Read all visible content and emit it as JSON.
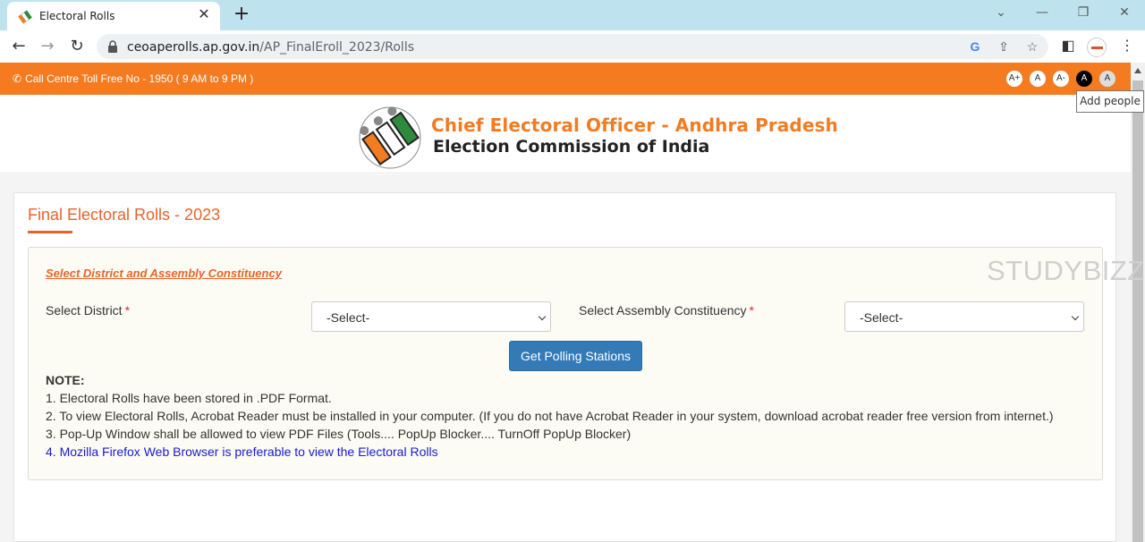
{
  "browser": {
    "tab_title": "Electoral Rolls",
    "tab_close": "✕",
    "new_tab": "+",
    "url_host": "ceoaperolls.ap.gov.in",
    "url_path": "/AP_FinalEroll_2023/Rolls",
    "tooltip": "Add people"
  },
  "topbar": {
    "call_centre": "Call Centre Toll Free No - 1950 ( 9 AM to 9 PM )",
    "font_buttons": [
      "A+",
      "A",
      "A-",
      "A",
      "A"
    ]
  },
  "header": {
    "title": "Chief Electoral Officer - Andhra Pradesh",
    "subtitle": "Election Commission of India"
  },
  "main": {
    "page_title": "Final Electoral Rolls - 2023",
    "section_heading": "Select District and Assembly Constituency",
    "district_label": "Select District",
    "district_value": "-Select-",
    "ac_label": "Select Assembly Constituency",
    "ac_value": "-Select-",
    "required_mark": "*",
    "button_label": "Get Polling Stations",
    "note_title": "NOTE:",
    "notes": [
      "1. Electoral Rolls have been stored in .PDF Format.",
      "2. To view Electoral Rolls, Acrobat Reader must be installed in your computer. (If you do not have Acrobat Reader in your system, download acrobat reader free version from internet.)",
      "3. Pop-Up Window shall be allowed to view PDF Files (Tools.... PopUp Blocker.... TurnOff PopUp Blocker)",
      "4. Mozilla Firefox Web Browser is preferable to view the Electoral Rolls"
    ]
  },
  "watermark": "STUDYBIZZ",
  "colors": {
    "accent_orange": "#f47b20",
    "title_orange": "#e8632c",
    "button_blue": "#337ab7",
    "note_blue": "#1a1ad4"
  },
  "icons": [
    "favicon-icon",
    "close-icon",
    "plus-icon",
    "back-icon",
    "forward-icon",
    "reload-icon",
    "lock-icon",
    "google-icon",
    "share-icon",
    "star-icon",
    "sidepanel-icon",
    "menu-icon",
    "phone-icon",
    "chevron-down-icon"
  ]
}
